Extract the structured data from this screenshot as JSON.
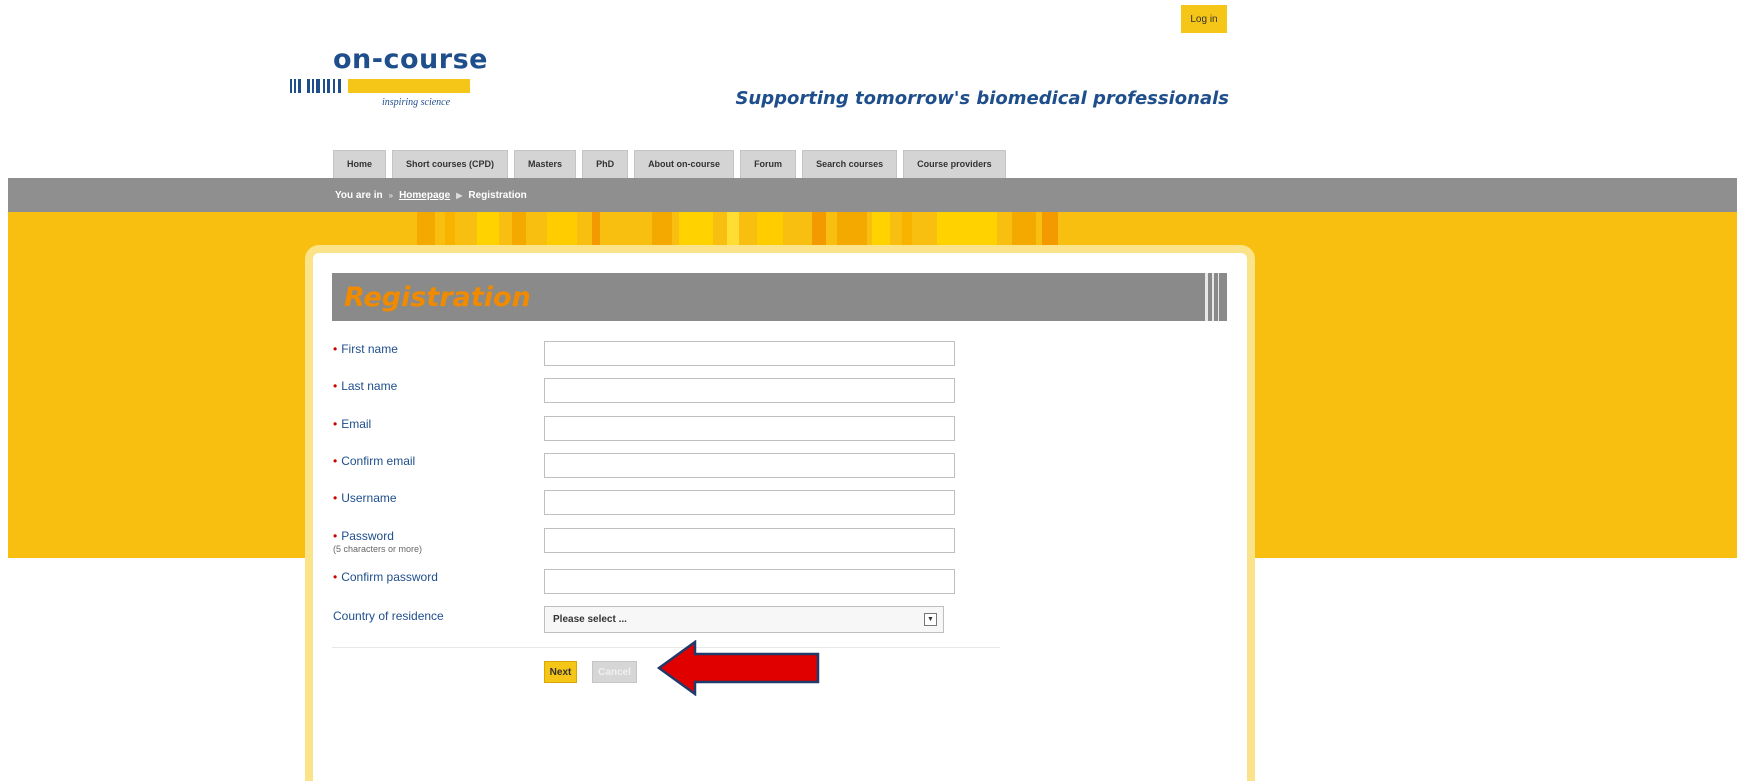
{
  "header": {
    "login_label": "Log in",
    "logo_text": "on-course",
    "logo_tagline": "inspiring science",
    "tagline": "Supporting tomorrow's biomedical professionals"
  },
  "nav": {
    "tabs": [
      {
        "label": "Home"
      },
      {
        "label": "Short courses (CPD)"
      },
      {
        "label": "Masters"
      },
      {
        "label": "PhD"
      },
      {
        "label": "About on-course"
      },
      {
        "label": "Forum"
      },
      {
        "label": "Search courses"
      },
      {
        "label": "Course providers"
      }
    ]
  },
  "breadcrumb": {
    "prefix": "You are in",
    "home": "Homepage",
    "current": "Registration"
  },
  "form": {
    "title": "Registration",
    "fields": [
      {
        "label": "First name",
        "required": true,
        "value": ""
      },
      {
        "label": "Last name",
        "required": true,
        "value": ""
      },
      {
        "label": "Email",
        "required": true,
        "value": ""
      },
      {
        "label": "Confirm email",
        "required": true,
        "value": ""
      },
      {
        "label": "Username",
        "required": true,
        "value": ""
      },
      {
        "label": "Password",
        "required": true,
        "hint": "(5 characters or more)",
        "value": ""
      },
      {
        "label": "Confirm password",
        "required": true,
        "value": ""
      }
    ],
    "country": {
      "label": "Country of residence",
      "selected": "Please select ..."
    },
    "next_label": "Next",
    "cancel_label": "Cancel"
  },
  "colors": {
    "brand_blue": "#1f4e8c",
    "brand_yellow": "#f5c518",
    "band_yellow": "#f9bf10",
    "nav_grey": "#8f8f8f",
    "title_orange": "#f08a00",
    "annotation_red": "#e00000"
  },
  "annotation": {
    "icon": "red-arrow-left-icon"
  }
}
